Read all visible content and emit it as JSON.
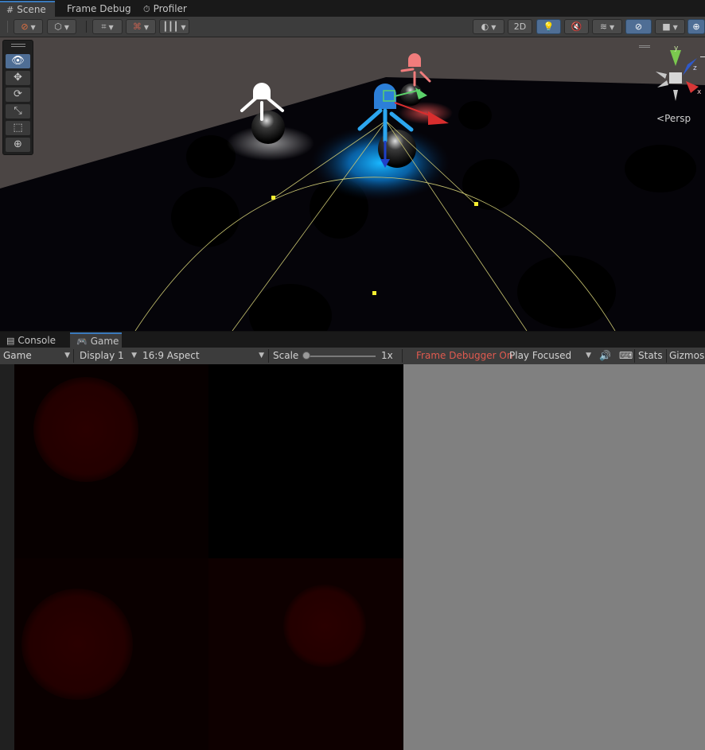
{
  "top_tabs": {
    "scene": {
      "label": "Scene",
      "icon": "grid-icon"
    },
    "frame_debug": {
      "label": "Frame Debug"
    },
    "profiler": {
      "label": "Profiler",
      "icon": "profiler-icon"
    }
  },
  "scene_toolbar": {
    "mode_2d_label": "2D",
    "icons": [
      "draw-mode-icon",
      "shading-cube-icon",
      "grid-snap-icon",
      "increment-snap-icon",
      "ruler-icon",
      "shading-sphere-icon",
      "light-bulb-icon",
      "audio-mute-icon",
      "effects-icon",
      "visibility-icon",
      "camera-icon",
      "gizmo-icon"
    ]
  },
  "scene_view": {
    "projection_label": "Persp",
    "gizmo_axes": {
      "y": "y",
      "z": "z",
      "x": "x"
    },
    "tools": [
      "view-tool",
      "move-tool",
      "rotate-tool",
      "scale-tool",
      "rect-tool",
      "transform-tool"
    ]
  },
  "panel_tabs": {
    "console": {
      "label": "Console",
      "icon": "console-icon"
    },
    "game": {
      "label": "Game",
      "icon": "gamepad-icon"
    }
  },
  "game_toolbar": {
    "view_select": "Game",
    "display_select": "Display 1",
    "aspect_select": "16:9 Aspect",
    "scale_label": "Scale",
    "scale_value": "1x",
    "scale_fraction": 0.0,
    "frame_debugger_status": "Frame Debugger On",
    "play_focused": "Play Focused",
    "stats_label": "Stats",
    "gizmos_label": "Gizmos"
  },
  "colors": {
    "accent": "#3a79bb",
    "active_button": "#4f6e95",
    "frame_debugger_status": "#e05a4f",
    "letterbox": "#808080"
  }
}
